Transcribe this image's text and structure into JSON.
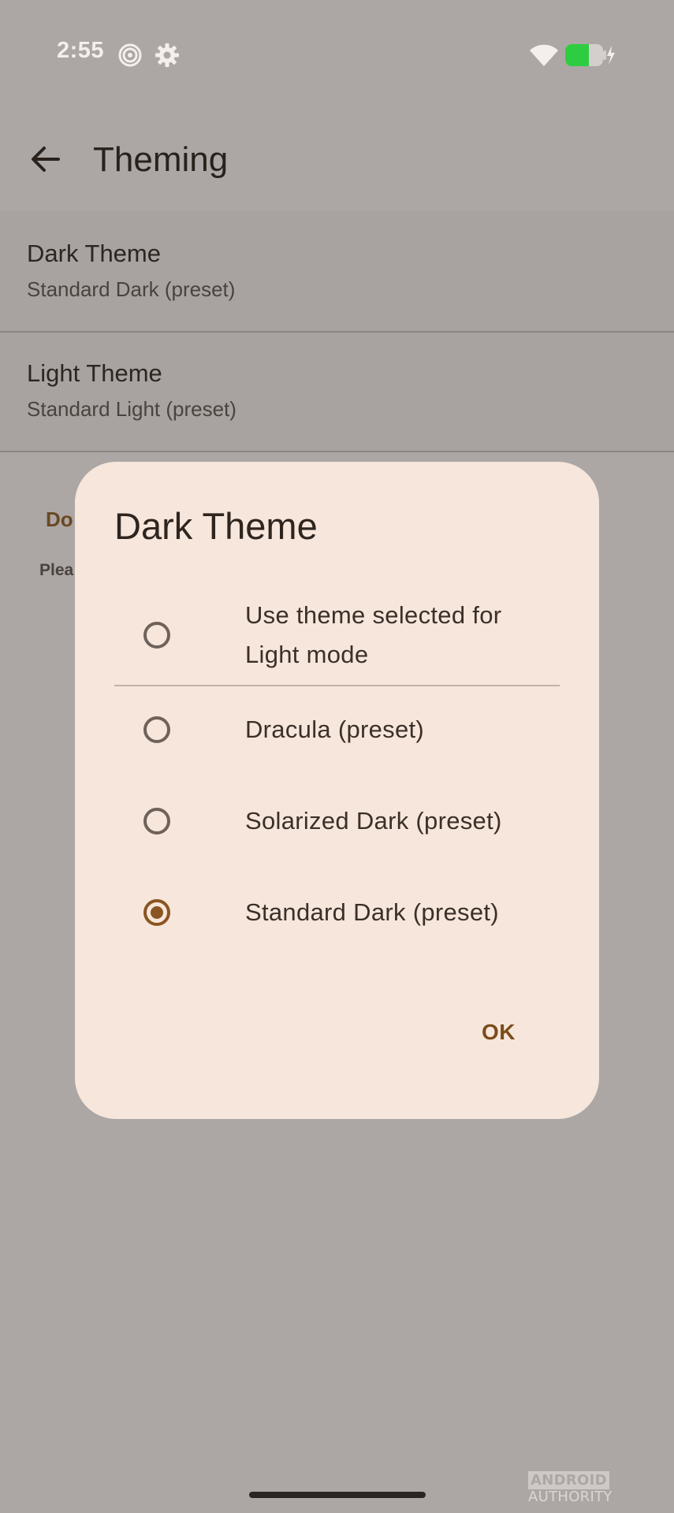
{
  "status_bar": {
    "time": "2:55",
    "icons": [
      "spiral-icon",
      "gear-icon",
      "wifi-icon",
      "battery-charging-icon"
    ],
    "battery_color": "#2ecc40"
  },
  "app_bar": {
    "title": "Theming"
  },
  "settings": [
    {
      "title": "Dark Theme",
      "subtitle": "Standard Dark (preset)"
    },
    {
      "title": "Light Theme",
      "subtitle": "Standard Light (preset)"
    }
  ],
  "background_peek": {
    "line1": "Do",
    "line2": "Plea"
  },
  "dialog": {
    "title": "Dark Theme",
    "options": [
      {
        "line1": "Use theme selected for",
        "line2": "Light mode",
        "selected": false
      },
      {
        "label": "Dracula (preset)",
        "selected": false
      },
      {
        "label": "Solarized Dark (preset)",
        "selected": false
      },
      {
        "label": "Standard Dark (preset)",
        "selected": true
      }
    ],
    "ok_label": "OK",
    "accent_color": "#8a5522"
  },
  "watermark": {
    "part1": "ANDROID",
    "part2": "AUTHORITY"
  }
}
